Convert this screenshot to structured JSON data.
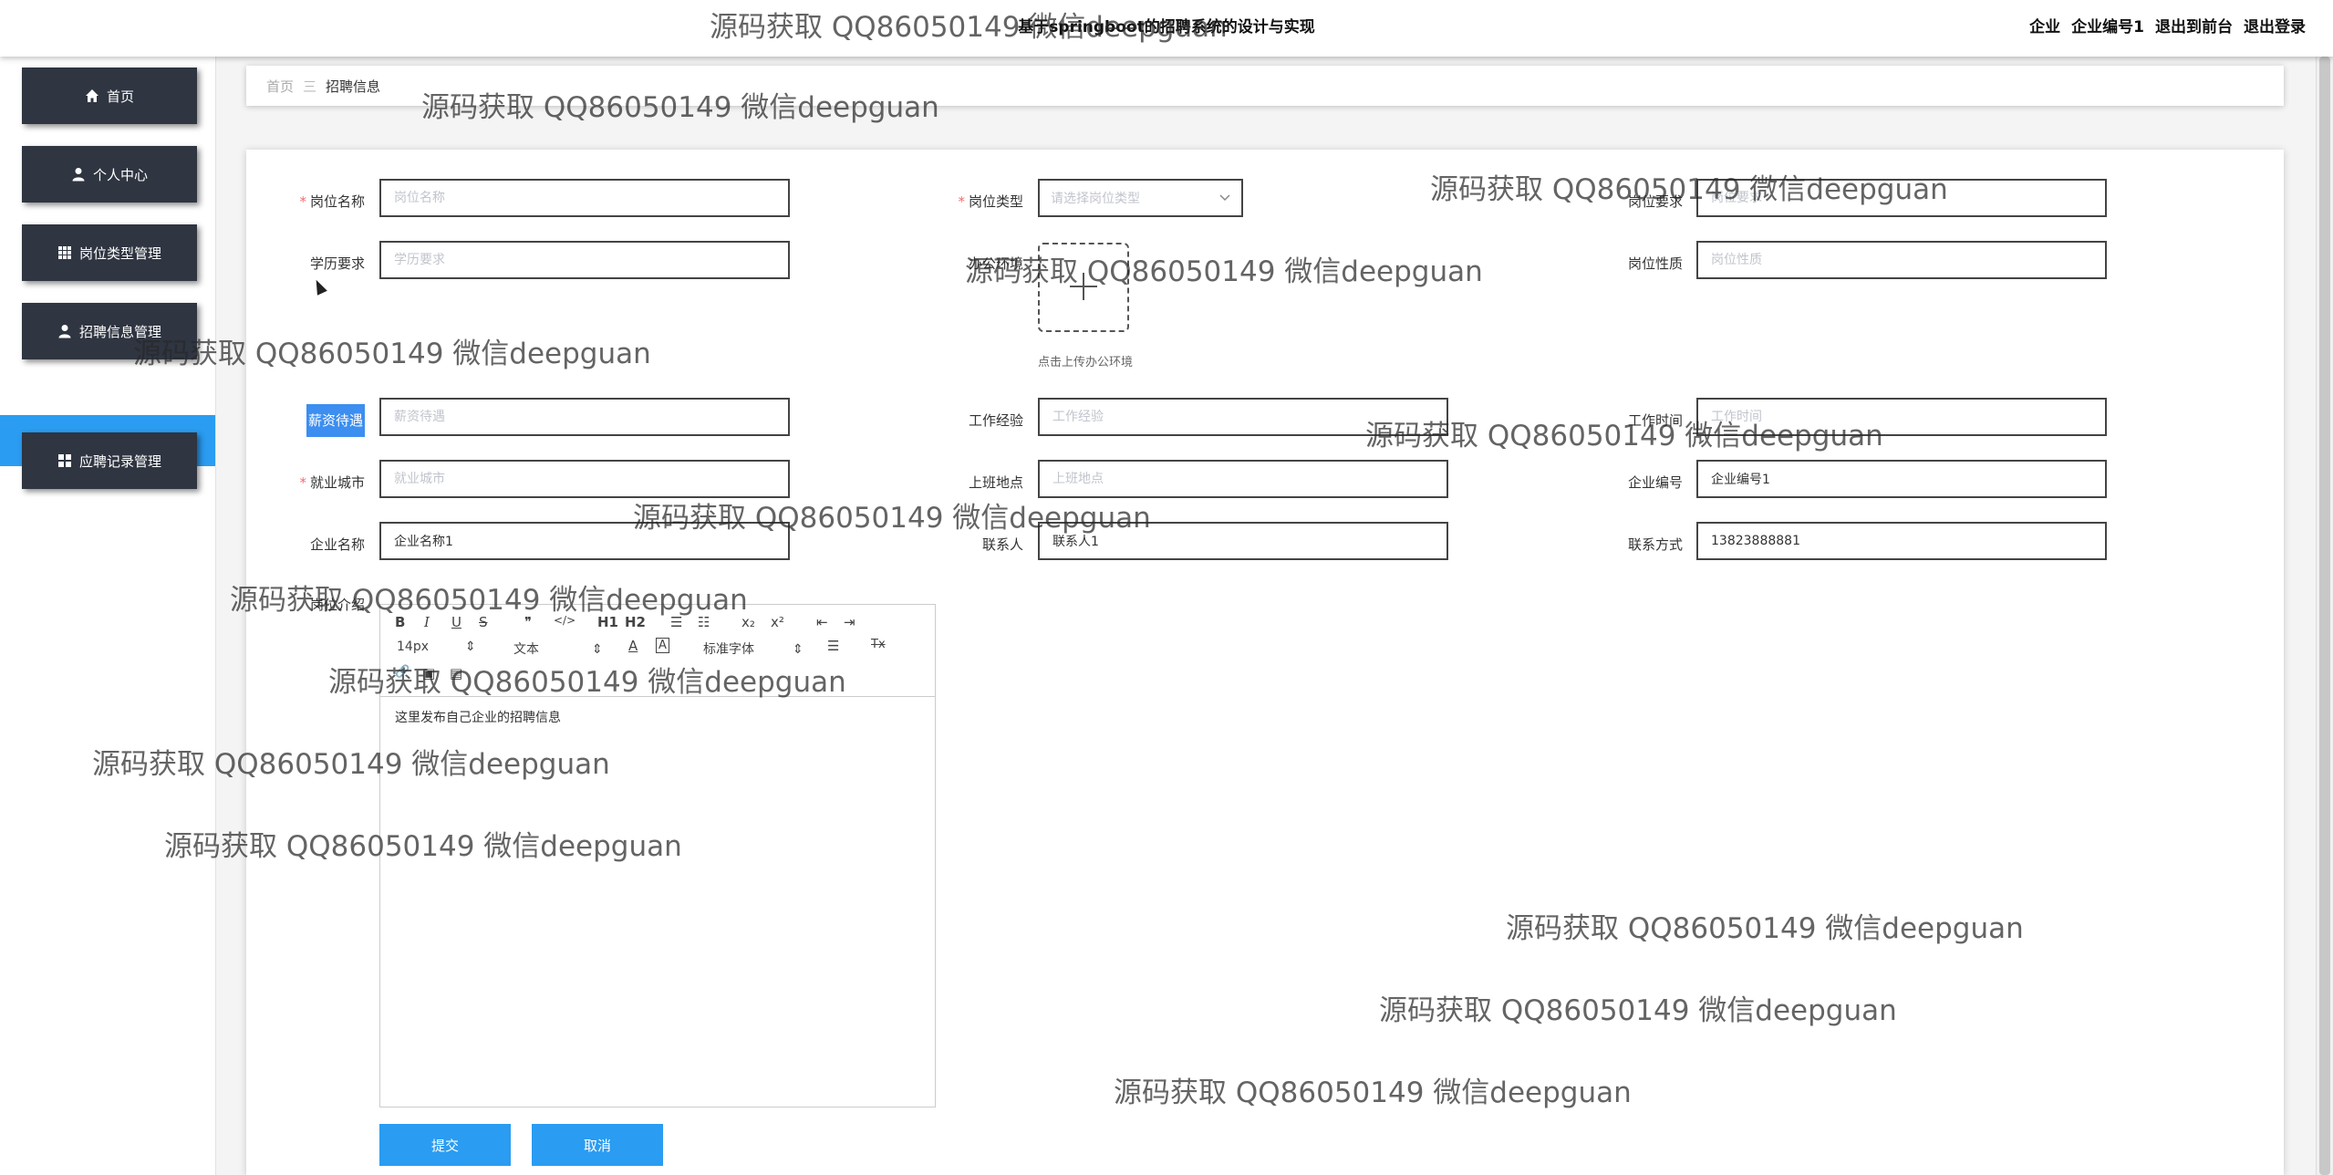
{
  "header": {
    "title": "基于springboot的招聘系统的设计与实现",
    "role_label": "企业",
    "user_label": "企业编号1",
    "back_label": "退出到前台",
    "logout_label": "退出登录"
  },
  "sidebar": {
    "items": [
      {
        "label": "首页",
        "icon": "home-icon"
      },
      {
        "label": "个人中心",
        "icon": "user-icon"
      },
      {
        "label": "岗位类型管理",
        "icon": "grid-icon"
      },
      {
        "label": "招聘信息管理",
        "icon": "user-icon"
      },
      {
        "label": "应聘记录管理",
        "icon": "grid-icon"
      }
    ],
    "active_subitem": "招聘信息"
  },
  "breadcrumb": {
    "home": "首页",
    "separator": "三",
    "current": "招聘信息"
  },
  "form": {
    "job_name": {
      "label": "岗位名称",
      "placeholder": "岗位名称",
      "value": ""
    },
    "job_type": {
      "label": "岗位类型",
      "placeholder": "请选择岗位类型"
    },
    "job_requirement": {
      "label": "岗位要求",
      "placeholder": "岗位要求",
      "value": ""
    },
    "education": {
      "label": "学历要求",
      "placeholder": "学历要求",
      "value": ""
    },
    "office_env": {
      "label": "办公环境",
      "tip": "点击上传办公环境"
    },
    "job_nature": {
      "label": "岗位性质",
      "placeholder": "岗位性质",
      "value": ""
    },
    "salary": {
      "label": "薪资待遇",
      "placeholder": "薪资待遇",
      "value": ""
    },
    "experience": {
      "label": "工作经验",
      "placeholder": "工作经验",
      "value": ""
    },
    "work_time": {
      "label": "工作时间",
      "placeholder": "工作时间",
      "value": ""
    },
    "city": {
      "label": "就业城市",
      "placeholder": "就业城市",
      "value": ""
    },
    "location": {
      "label": "上班地点",
      "placeholder": "上班地点",
      "value": ""
    },
    "company_no": {
      "label": "企业编号",
      "value": "企业编号1"
    },
    "company_name": {
      "label": "企业名称",
      "value": "企业名称1"
    },
    "contact": {
      "label": "联系人",
      "value": "联系人1"
    },
    "phone": {
      "label": "联系方式",
      "value": "13823888881"
    },
    "description": {
      "label": "岗位介绍"
    }
  },
  "editor": {
    "toolbar": {
      "bold": "B",
      "italic": "I",
      "underline": "U",
      "strike": "S",
      "quote": "❞",
      "code": "</>",
      "h1": "H1",
      "h2": "H2",
      "ol": "☰",
      "ul": "☷",
      "sub": "x₂",
      "sup": "x²",
      "outdent": "⇤",
      "indent": "⇥",
      "size": "14px",
      "header": "文本",
      "font_color": "A",
      "bg_color": "A",
      "font_family": "标准字体",
      "align": "☰",
      "clean": "Tx",
      "link": "🔗",
      "image": "▣",
      "video": "▤"
    },
    "content": "这里发布自己企业的招聘信息"
  },
  "buttons": {
    "submit": "提交",
    "cancel": "取消"
  },
  "watermark": "源码获取 QQ86050149 微信deepguan",
  "colors": {
    "sidebar_bg": "#2f3541",
    "accent": "#2a9cf1",
    "required": "#f56c6c"
  }
}
